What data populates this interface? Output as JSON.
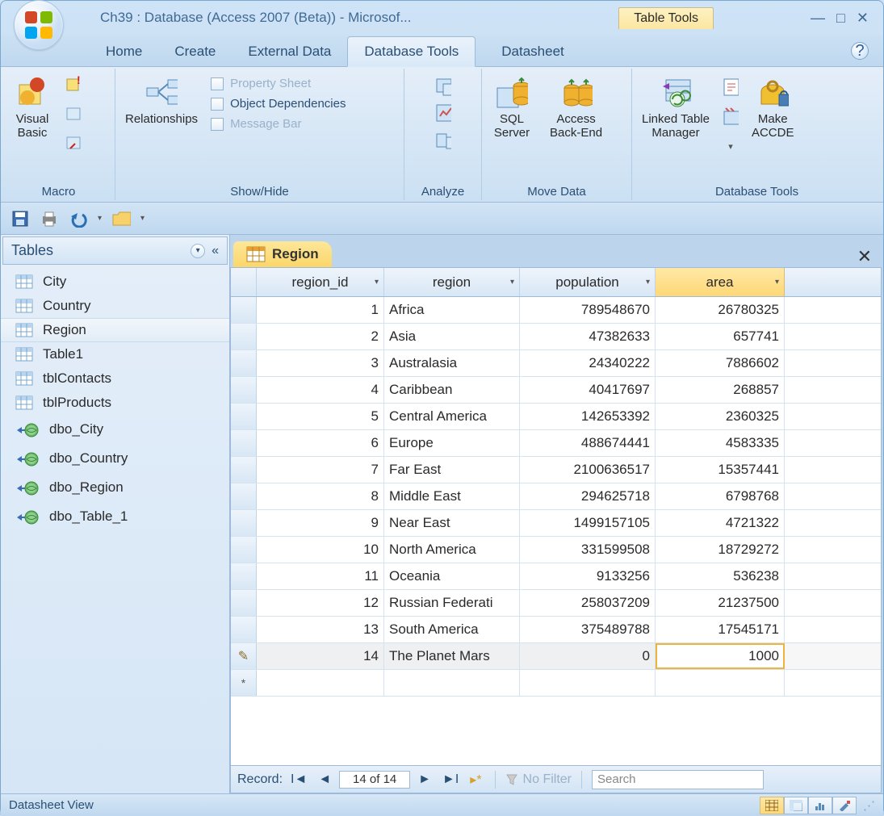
{
  "window": {
    "title": "Ch39 : Database (Access 2007 (Beta)) - Microsof...",
    "contextual_tab_group": "Table Tools"
  },
  "tabs": {
    "home": "Home",
    "create": "Create",
    "external": "External Data",
    "dbtools": "Database Tools",
    "datasheet": "Datasheet"
  },
  "ribbon": {
    "macro": {
      "label": "Macro",
      "visual_basic": "Visual\nBasic"
    },
    "showhide": {
      "label": "Show/Hide",
      "relationships": "Relationships",
      "property_sheet": "Property Sheet",
      "object_deps": "Object Dependencies",
      "message_bar": "Message Bar"
    },
    "analyze": {
      "label": "Analyze"
    },
    "movedata": {
      "label": "Move Data",
      "sql": "SQL\nServer",
      "access": "Access\nBack-End"
    },
    "dbtools": {
      "label": "Database Tools",
      "linked": "Linked Table\nManager",
      "accde": "Make\nACCDE"
    }
  },
  "nav": {
    "header": "Tables",
    "items": [
      "City",
      "Country",
      "Region",
      "Table1",
      "tblContacts",
      "tblProducts"
    ],
    "linked": [
      "dbo_City",
      "dbo_Country",
      "dbo_Region",
      "dbo_Table_1"
    ]
  },
  "datasheet": {
    "tab": "Region",
    "columns": [
      "region_id",
      "region",
      "population",
      "area"
    ],
    "rows": [
      {
        "id": 1,
        "region": "Africa",
        "pop": "789548670",
        "area": "26780325"
      },
      {
        "id": 2,
        "region": "Asia",
        "pop": "47382633",
        "area": "657741"
      },
      {
        "id": 3,
        "region": "Australasia",
        "pop": "24340222",
        "area": "7886602"
      },
      {
        "id": 4,
        "region": "Caribbean",
        "pop": "40417697",
        "area": "268857"
      },
      {
        "id": 5,
        "region": "Central America",
        "pop": "142653392",
        "area": "2360325"
      },
      {
        "id": 6,
        "region": "Europe",
        "pop": "488674441",
        "area": "4583335"
      },
      {
        "id": 7,
        "region": "Far East",
        "pop": "2100636517",
        "area": "15357441"
      },
      {
        "id": 8,
        "region": "Middle East",
        "pop": "294625718",
        "area": "6798768"
      },
      {
        "id": 9,
        "region": "Near East",
        "pop": "1499157105",
        "area": "4721322"
      },
      {
        "id": 10,
        "region": "North America",
        "pop": "331599508",
        "area": "18729272"
      },
      {
        "id": 11,
        "region": "Oceania",
        "pop": "9133256",
        "area": "536238"
      },
      {
        "id": 12,
        "region": "Russian Federati",
        "pop": "258037209",
        "area": "21237500"
      },
      {
        "id": 13,
        "region": "South America",
        "pop": "375489788",
        "area": "17545171"
      },
      {
        "id": 14,
        "region": "The Planet Mars",
        "pop": "0",
        "area": "1000"
      }
    ]
  },
  "recnav": {
    "label": "Record:",
    "pos": "14 of 14",
    "nofilter": "No Filter",
    "search": "Search"
  },
  "status": {
    "view": "Datasheet View"
  }
}
